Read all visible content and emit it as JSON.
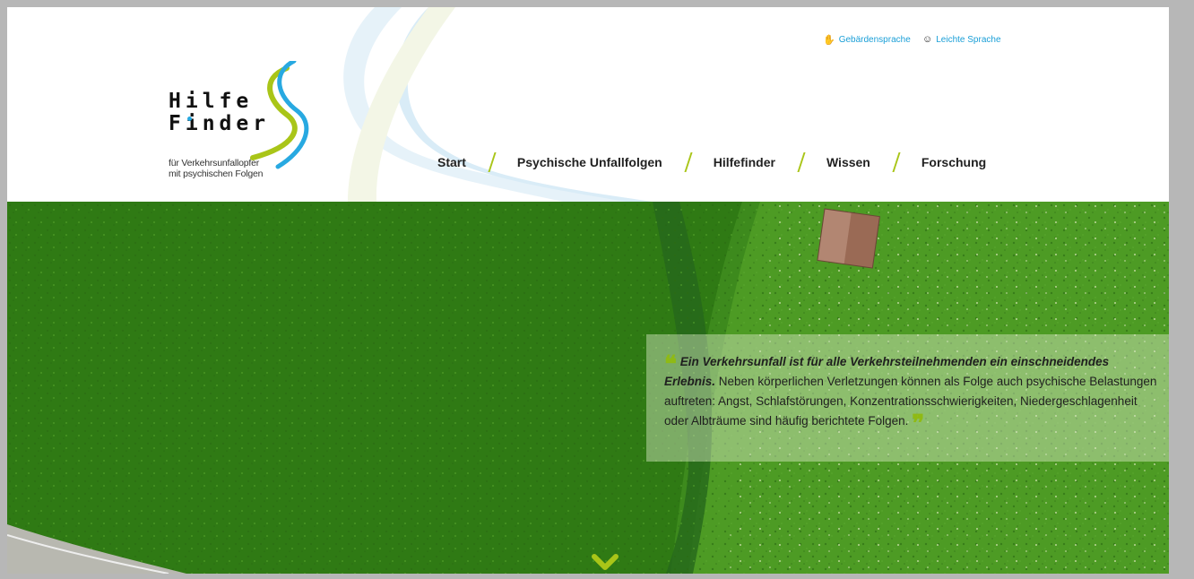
{
  "header": {
    "logo": {
      "line1": "Hilfe",
      "line2": "Finder",
      "subtitle_line1": "für Verkehrsunfallopfer",
      "subtitle_line2": "mit psychischen Folgen"
    },
    "language_links": [
      {
        "label": "Gebärdensprache",
        "icon": "sign-language-hand-icon"
      },
      {
        "label": "Leichte Sprache",
        "icon": "easy-language-icon"
      }
    ],
    "nav": [
      {
        "label": "Start",
        "active": true
      },
      {
        "label": "Psychische Unfallfolgen"
      },
      {
        "label": "Hilfefinder"
      },
      {
        "label": "Wissen"
      },
      {
        "label": "Forschung"
      }
    ]
  },
  "hero": {
    "quote_bold": "Ein Verkehrsunfall ist für alle Verkehrsteilnehmenden ein einschneidendes Erlebnis.",
    "quote_text": " Neben körperlichen Verletzungen können als Folge auch psychische Belastungen auftreten: Angst, Schlafstörungen, Konzentrationsschwierigkeiten, Niedergeschlagenheit oder Albträume sind häufig berichtete Folgen.",
    "scroll_icon": "chevron-down-icon"
  },
  "colors": {
    "accent_green": "#a9c518",
    "accent_blue": "#28a9e1",
    "link_blue": "#1a9fd7"
  }
}
